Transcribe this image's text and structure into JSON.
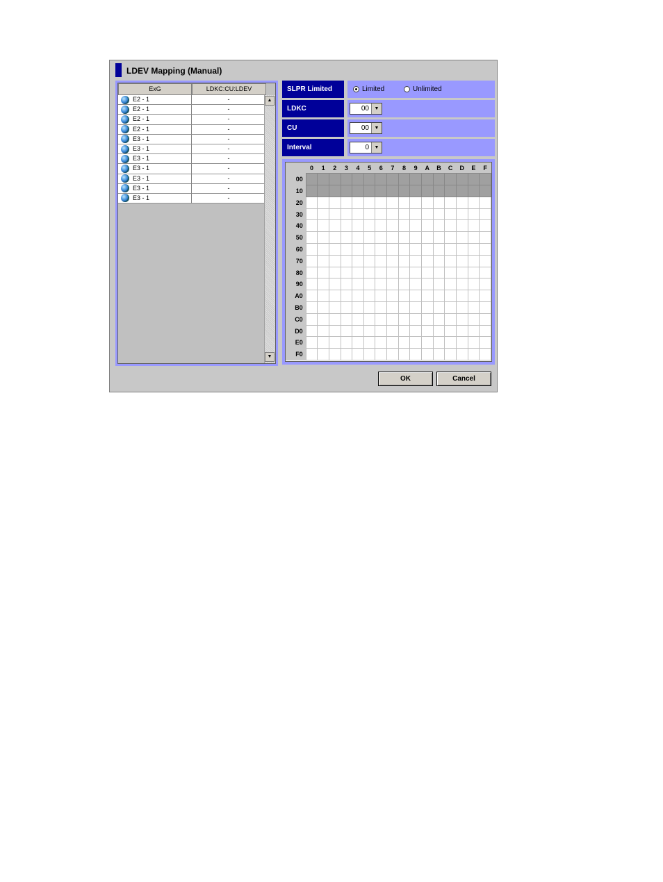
{
  "dialog": {
    "title": "LDEV Mapping (Manual)"
  },
  "table": {
    "columns": [
      "ExG",
      "LDKC:CU:LDEV"
    ],
    "rows": [
      {
        "exg": "E2 - 1",
        "ldev": "-"
      },
      {
        "exg": "E2 - 1",
        "ldev": "-"
      },
      {
        "exg": "E2 - 1",
        "ldev": "-"
      },
      {
        "exg": "E2 - 1",
        "ldev": "-"
      },
      {
        "exg": "E3 - 1",
        "ldev": "-"
      },
      {
        "exg": "E3 - 1",
        "ldev": "-"
      },
      {
        "exg": "E3 - 1",
        "ldev": "-"
      },
      {
        "exg": "E3 - 1",
        "ldev": "-"
      },
      {
        "exg": "E3 - 1",
        "ldev": "-"
      },
      {
        "exg": "E3 - 1",
        "ldev": "-"
      },
      {
        "exg": "E3 - 1",
        "ldev": "-"
      }
    ]
  },
  "settings": {
    "slpr": {
      "label": "SLPR Limited",
      "options": [
        "Limited",
        "Unlimited"
      ],
      "selected": "Limited"
    },
    "ldkc": {
      "label": "LDKC",
      "value": "00"
    },
    "cu": {
      "label": "CU",
      "value": "00"
    },
    "interval": {
      "label": "Interval",
      "value": "0"
    }
  },
  "grid": {
    "col_headers": [
      "0",
      "1",
      "2",
      "3",
      "4",
      "5",
      "6",
      "7",
      "8",
      "9",
      "A",
      "B",
      "C",
      "D",
      "E",
      "F"
    ],
    "row_headers": [
      "00",
      "10",
      "20",
      "30",
      "40",
      "50",
      "60",
      "70",
      "80",
      "90",
      "A0",
      "B0",
      "C0",
      "D0",
      "E0",
      "F0"
    ],
    "used_rows": [
      "00",
      "10"
    ]
  },
  "buttons": {
    "ok": "OK",
    "cancel": "Cancel"
  },
  "colors": {
    "label_bg": "#000099",
    "panel_bg": "#9999ff",
    "dialog_bg": "#c8c8c8",
    "used_cell": "#a0a0a0"
  }
}
